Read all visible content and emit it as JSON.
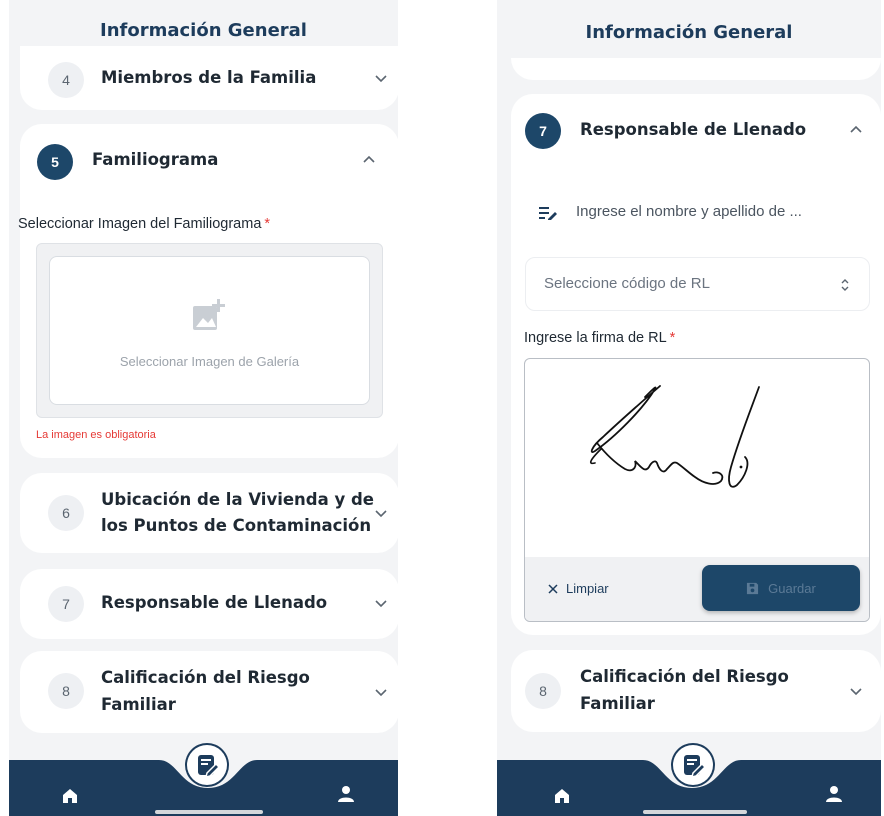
{
  "left": {
    "header": {
      "title": "Información General"
    },
    "sections": [
      {
        "number": "4",
        "title": "Miembros de la Familia"
      },
      {
        "number": "5",
        "title": "Familiograma"
      },
      {
        "number": "6",
        "title_line1": "Ubicación de la Vivienda y de",
        "title_line2": "los Puntos de Contaminación"
      },
      {
        "number": "7",
        "title": "Responsable de Llenado"
      },
      {
        "number": "8",
        "title_line1": "Calificación del Riesgo",
        "title_line2": "Familiar"
      }
    ],
    "familiograma": {
      "image_label": "Seleccionar Imagen del Familiograma",
      "required_mark": "*",
      "dropzone_text": "Seleccionar Imagen de Galería",
      "error_text": "La imagen es obligatoria"
    }
  },
  "right": {
    "header": {
      "title": "Información General"
    },
    "section7": {
      "number": "7",
      "title": "Responsable de Llenado"
    },
    "name_input": {
      "value": "Ingrese el nombre y apellido de ..."
    },
    "code_select": {
      "placeholder": "Seleccione código de RL"
    },
    "signature": {
      "label": "Ingrese la firma de RL",
      "required_mark": "*",
      "clear_label": "Limpiar",
      "save_label": "Guardar"
    },
    "section8": {
      "number": "8",
      "title_line1": "Calificación del Riesgo",
      "title_line2": "Familiar"
    }
  },
  "nav": {
    "items": [
      "home-icon",
      "edit-form-icon",
      "profile-icon"
    ]
  },
  "colors": {
    "primary": "#1d3c5c",
    "accent": "#1d4769",
    "background": "#f3f4f6",
    "error": "#e53935"
  }
}
